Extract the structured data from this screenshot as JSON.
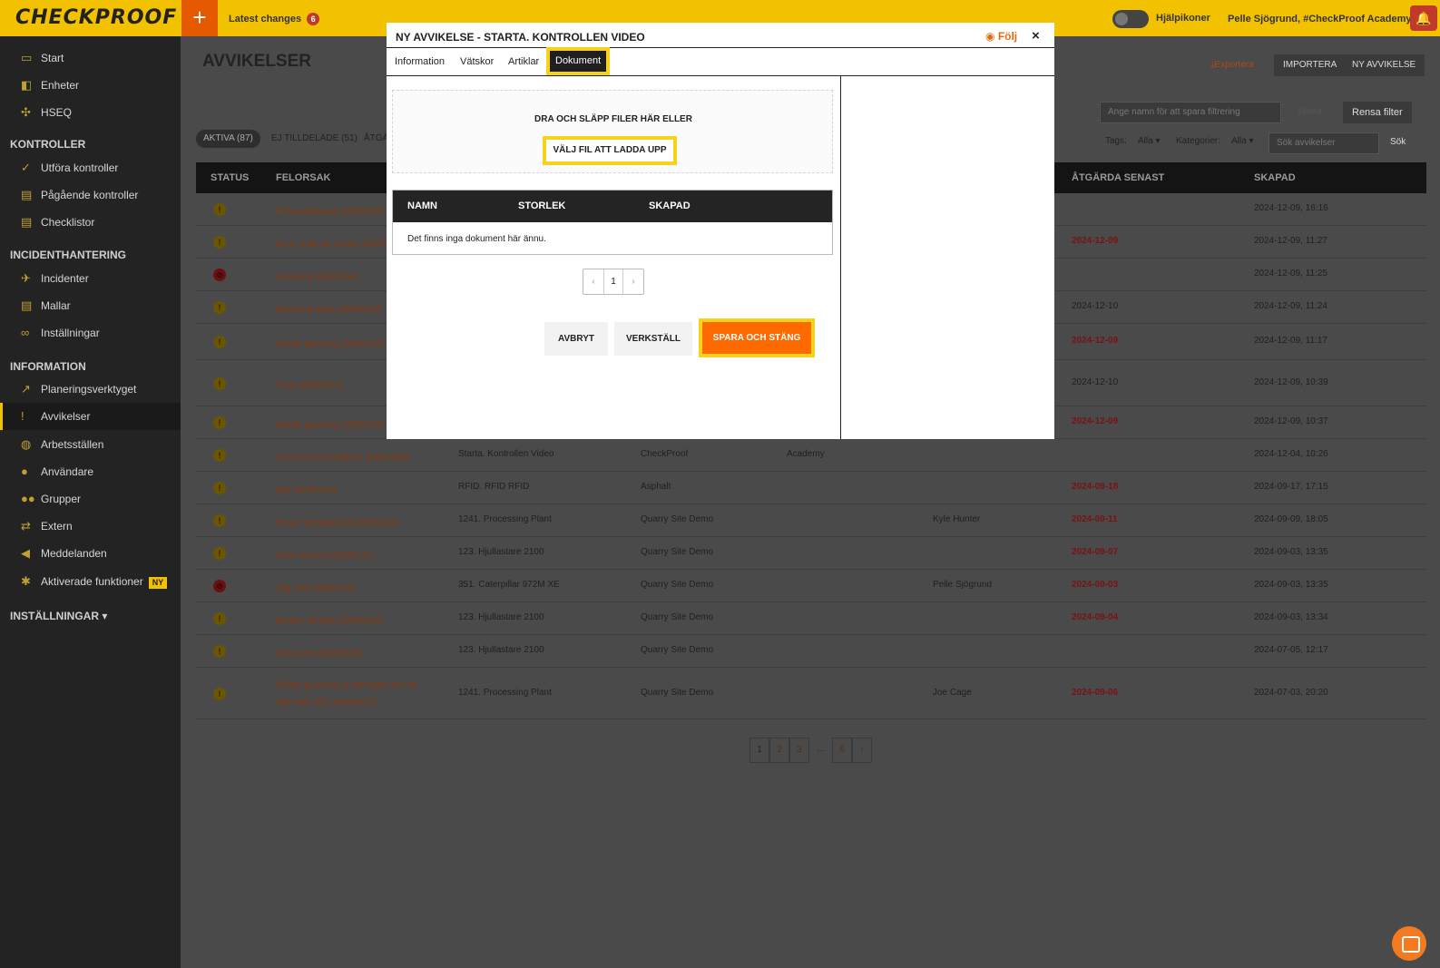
{
  "topbar": {
    "logo": "CHECKPROOF",
    "plus": "+",
    "latest_label": "Latest changes",
    "latest_count": "6",
    "help_label": "Hjälpikoner",
    "user_label": "Pelle Sjögrund, #CheckProof Academy ▾",
    "bell": "🔔"
  },
  "sidebar": {
    "items_top": [
      {
        "label": "Start",
        "icon": "monitor-icon",
        "glyph": "▭"
      },
      {
        "label": "Enheter",
        "icon": "truck-icon",
        "glyph": "◧"
      },
      {
        "label": "HSEQ",
        "icon": "hseq-icon",
        "glyph": "✣"
      }
    ],
    "head_kontroller": "KONTROLLER",
    "items_kontroller": [
      {
        "label": "Utföra kontroller",
        "icon": "check-circle-icon",
        "glyph": "✓"
      },
      {
        "label": "Pågående kontroller",
        "icon": "clipboard-icon",
        "glyph": "▤"
      },
      {
        "label": "Checklistor",
        "icon": "list-icon",
        "glyph": "▤"
      }
    ],
    "head_incident": "INCIDENTHANTERING",
    "items_incident": [
      {
        "label": "Incidenter",
        "icon": "running-icon",
        "glyph": "✈"
      },
      {
        "label": "Mallar",
        "icon": "clipboard-icon",
        "glyph": "▤"
      },
      {
        "label": "Inställningar",
        "icon": "link-icon",
        "glyph": "∞"
      }
    ],
    "head_info": "INFORMATION",
    "items_info": [
      {
        "label": "Planeringsverktyget",
        "icon": "chart-line-icon",
        "glyph": "↗"
      },
      {
        "label": "Avvikelser",
        "icon": "exclamation-circle-icon",
        "glyph": "!"
      },
      {
        "label": "Arbetsställen",
        "icon": "globe-icon",
        "glyph": "◍"
      },
      {
        "label": "Användare",
        "icon": "user-icon",
        "glyph": "●"
      },
      {
        "label": "Grupper",
        "icon": "users-icon",
        "glyph": "●●"
      },
      {
        "label": "Extern",
        "icon": "handshake-icon",
        "glyph": "⇄"
      },
      {
        "label": "Meddelanden",
        "icon": "megaphone-icon",
        "glyph": "◀"
      },
      {
        "label": "Aktiverade funktioner",
        "icon": "puzzle-icon",
        "glyph": "✱",
        "badge": "NY"
      }
    ],
    "head_settings": "INSTÄLLNINGAR ▾"
  },
  "main": {
    "title": "AVVIKELSER",
    "export": "⤓Exportera",
    "import": "IMPORTERA",
    "new": "NY AVVIKELSE",
    "filter_placeholder": "Ange namn för att spara filtrering",
    "save_filter": "Spara",
    "clear_filter": "Rensa filter",
    "tabs": [
      "AKTIVA (87)",
      "EJ TILLDELADE (51)",
      "ÅTGÄ"
    ],
    "tags_label": "Tags:",
    "tags_value": "Alla ▾",
    "cats_label": "Kategorier:",
    "cats_value": "Alla ▾",
    "search_placeholder": "Sök avvikelser",
    "search_btn": "Sök",
    "columns": {
      "status": "STATUS",
      "cause": "FELORSAK",
      "fix_by": "ÅTGÄRDA SENAST",
      "created": "SKAPAD"
    },
    "rows": [
      {
        "status": "warn",
        "cause": "Felmeddelande (D000156)",
        "unit": "",
        "site": "",
        "group": "",
        "assignee": "",
        "fix": "",
        "fix_red": false,
        "created": "2024-12-09, 16:16"
      },
      {
        "status": "warn",
        "cause": "Error code on screen (D000",
        "unit": "",
        "site": "",
        "group": "",
        "assignee": "",
        "fix": "2024-12-09",
        "fix_red": true,
        "created": "2024-12-09, 11:27"
      },
      {
        "status": "stop",
        "cause": "Greasing (D000154)",
        "unit": "",
        "site": "",
        "group": "",
        "assignee": "",
        "fix": "",
        "fix_red": false,
        "created": "2024-12-09, 11:25"
      },
      {
        "status": "warn",
        "cause": "Electrical issue (D000153)",
        "unit": "",
        "site": "",
        "group": "",
        "assignee": "",
        "fix": "2024-12-10",
        "fix_red": false,
        "created": "2024-12-09, 11:24"
      },
      {
        "status": "warn",
        "cause": "Needs greasing (D000152)",
        "unit": "",
        "site": "",
        "group": "",
        "assignee": "",
        "fix": "2024-12-09",
        "fix_red": true,
        "created": "2024-12-09, 11:17"
      },
      {
        "status": "warn",
        "cause": "Test2 (D000151)",
        "unit": "",
        "site": "",
        "group": "",
        "assignee": "",
        "fix": "2024-12-10",
        "fix_red": false,
        "created": "2024-12-09, 10:39"
      },
      {
        "status": "warn",
        "cause": "Needs greasing (D000150)",
        "unit": "",
        "site": "",
        "group": "",
        "assignee": "",
        "fix": "2024-12-09",
        "fix_red": true,
        "created": "2024-12-09, 10:37"
      },
      {
        "status": "warn",
        "cause": "CheckProof Academy (D000148)",
        "unit": "Starta. Kontrollen Video",
        "site": "CheckProof",
        "group": "Academy",
        "assignee": "",
        "fix": "",
        "fix_red": false,
        "created": "2024-12-04, 10:26"
      },
      {
        "status": "warn",
        "cause": "Elie (D000145)",
        "unit": "RFID. RFID RFID",
        "site": "Asphalt",
        "group": "",
        "assignee": "",
        "fix": "2024-09-18",
        "fix_red": true,
        "created": "2024-09-17, 17:15"
      },
      {
        "status": "warn",
        "cause": "House keeping [S1] (D000142)",
        "unit": "1241. Processing Plant",
        "site": "Quarry Site Demo",
        "group": "",
        "assignee": "Kyle Hunter",
        "fix": "2024-09-11",
        "fix_red": true,
        "created": "2024-09-09, 18:05"
      },
      {
        "status": "warn",
        "cause": "Door is loose (D000141)",
        "unit": "123. Hjullastare 2100",
        "site": "Quarry Site Demo",
        "group": "",
        "assignee": "",
        "fix": "2024-09-07",
        "fix_red": true,
        "created": "2024-09-03, 13:35"
      },
      {
        "status": "stop",
        "cause": "Låg nivå (D000140)",
        "unit": "351. Caterpillar 972M XE",
        "site": "Quarry Site Demo",
        "group": "",
        "assignee": "Pelle Sjögrund",
        "fix": "2024-09-03",
        "fix_red": true,
        "created": "2024-09-03, 13:35"
      },
      {
        "status": "warn",
        "cause": "Broken window (D000139)",
        "unit": "123. Hjullastare 2100",
        "site": "Quarry Site Demo",
        "group": "",
        "assignee": "",
        "fix": "2024-09-04",
        "fix_red": true,
        "created": "2024-09-03, 13:34"
      },
      {
        "status": "warn",
        "cause": "Dokument (D000138)",
        "unit": "123. Hjullastare 2100",
        "site": "Quarry Site Demo",
        "group": "",
        "assignee": "",
        "fix": "",
        "fix_red": false,
        "created": "2024-07-05, 12:17"
      },
      {
        "status": "warn",
        "cause": "Safety guarding is damaged on the right side [S1] (D000137)",
        "unit": "1241. Processing Plant",
        "site": "Quarry Site Demo",
        "group": "",
        "assignee": "Joe Cage",
        "fix": "2024-09-06",
        "fix_red": true,
        "created": "2024-07-03, 20:20"
      }
    ],
    "pages": [
      "1",
      "2",
      "3",
      "…",
      "6",
      "›"
    ]
  },
  "modal": {
    "title": "NY AVVIKELSE - STARTA. KONTROLLEN VIDEO",
    "follow": "Följ",
    "close": "×",
    "tabs": [
      "Information",
      "Vätskor",
      "Artiklar",
      "Dokument"
    ],
    "active_tab": "Dokument",
    "dropzone_text": "DRA OCH SLÄPP FILER HÄR ELLER",
    "upload_button": "VÄLJ FIL ATT LADDA UPP",
    "doc_columns": [
      "NAMN",
      "STORLEK",
      "SKAPAD"
    ],
    "empty_text": "Det finns inga dokument här ännu.",
    "pager": {
      "prev": "‹",
      "page": "1",
      "next": "›"
    },
    "cancel": "AVBRYT",
    "apply": "VERKSTÄLL",
    "save_close": "SPARA OCH STÄNG"
  },
  "colors": {
    "brand": "#f2c200",
    "accent": "#ff6a00",
    "highlight": "#f7d21c"
  }
}
